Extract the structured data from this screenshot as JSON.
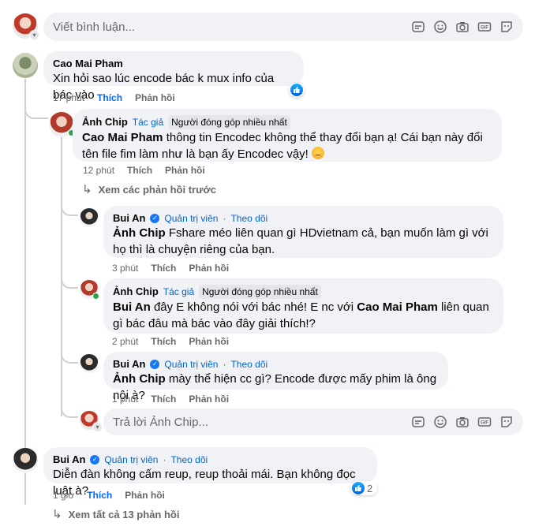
{
  "composer": {
    "placeholder": "Viết bình luận..."
  },
  "icons": [
    "sticker-icon",
    "emoji-icon",
    "camera-icon",
    "gif-icon",
    "sticker-face-icon"
  ],
  "badges": {
    "author": "Tác giả",
    "top_contributor": "Người đóng góp nhiều nhất",
    "admin": "Quản trị viên",
    "follow": "Theo dõi",
    "separator": "·"
  },
  "actions": {
    "like": "Thích",
    "reply": "Phản hồi"
  },
  "comments": [
    {
      "author": "Cao Mai Pham",
      "text": "Xin hỏi sao lúc encode bác k mux info của bác vào",
      "time": "17 phút"
    },
    {
      "author": "Ảnh Chip",
      "mention": "Cao Mai Pham",
      "text": " thông tin Encodec không thể thay đổi bạn ạ! Cái bạn này đổi tên file fim làm như là bạn ấy Encodec vậy! ",
      "time": "12 phút"
    },
    {
      "author": "Bui An",
      "mention": "Ảnh Chip",
      "text": " Fshare méo liên quan gì HDvietnam cả, bạn muốn làm gì với họ thì là chuyện riêng của bạn.",
      "time": "3 phút"
    },
    {
      "author": "Ảnh Chip",
      "mention": "Bui An",
      "text_a": " đây E không nói với bác nhé! E nc với ",
      "mention_b": "Cao Mai Pham",
      "text_b": " liên quan gì bác đâu mà bác vào đây giải thích!?",
      "time": "2 phút"
    },
    {
      "author": "Bui An",
      "mention": "Ảnh Chip",
      "text": " mày thể hiện cc gì? Encode được mấy phim là ông nội à?",
      "time": "1 phút"
    },
    {
      "author": "Bui An",
      "text": "Diễn đàn không cấm reup, reup thoải mái. Bạn không đọc luật à?",
      "time": "1 giờ",
      "reactions": "2"
    }
  ],
  "see_previous": "Xem các phản hồi trước",
  "reply_composer": {
    "placeholder": "Trả lời Ảnh Chip..."
  },
  "see_all": "Xem tất cả 13 phản hồi"
}
